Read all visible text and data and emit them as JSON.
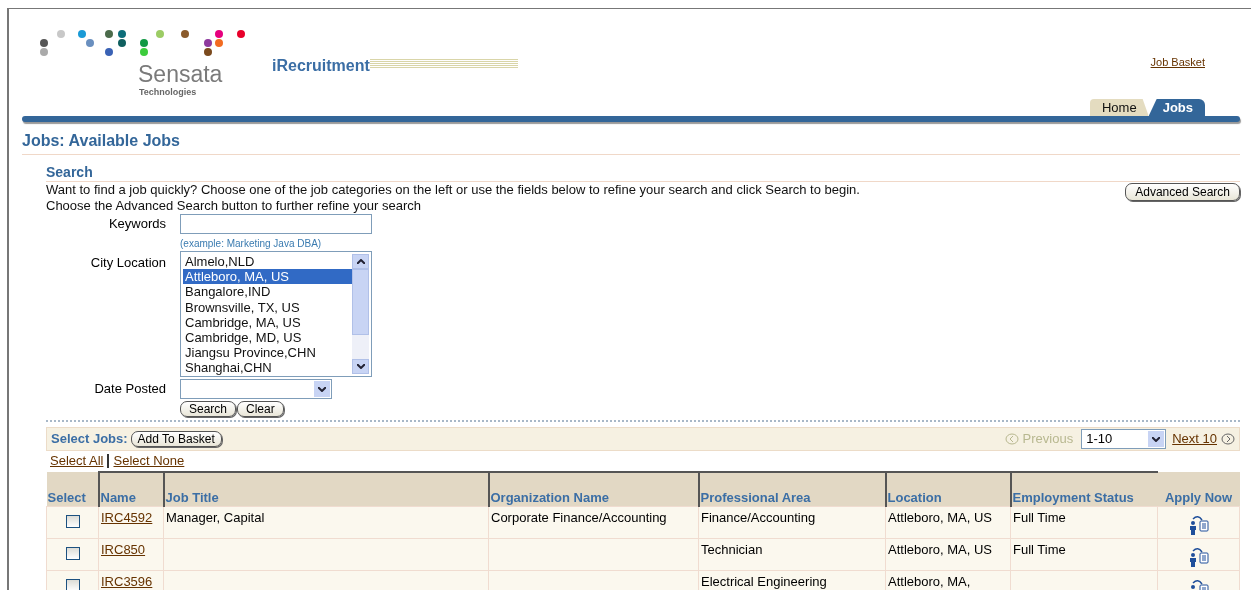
{
  "header": {
    "logo_name": "Sensata",
    "logo_subtitle": "Technologies",
    "app_title": "iRecruitment",
    "global_link": "Job Basket"
  },
  "tabs": [
    {
      "label": "Home",
      "selected": false
    },
    {
      "label": "Jobs",
      "selected": true
    }
  ],
  "page_title": "Jobs: Available Jobs",
  "search": {
    "heading": "Search",
    "instructions": [
      "Want to find a job quickly? Choose one of the job categories on the left or use the fields below to refine your search and click Search to begin.",
      "Choose the Advanced Search button to further refine your search"
    ],
    "advanced_button": "Advanced Search",
    "keywords": {
      "label": "Keywords",
      "hint": "(example: Marketing Java DBA)"
    },
    "city_location": {
      "label": "City Location",
      "options": [
        {
          "label": "Almelo,NLD",
          "selected": false
        },
        {
          "label": "Attleboro, MA, US",
          "selected": true
        },
        {
          "label": "Bangalore,IND",
          "selected": false
        },
        {
          "label": "Brownsville, TX, US",
          "selected": false
        },
        {
          "label": "Cambridge, MA, US",
          "selected": false
        },
        {
          "label": "Cambridge, MD, US",
          "selected": false
        },
        {
          "label": "Jiangsu Province,CHN",
          "selected": false
        },
        {
          "label": "Shanghai,CHN",
          "selected": false
        }
      ]
    },
    "date_posted": {
      "label": "Date Posted"
    },
    "buttons": [
      "Search",
      "Clear"
    ]
  },
  "results": {
    "select_label": "Select Jobs:",
    "add_button": "Add To Basket",
    "previous": {
      "label": "Previous",
      "disabled": true
    },
    "range": "1-10",
    "next": "Next 10",
    "select_all": "Select All",
    "select_none": "Select None",
    "columns": [
      "Select",
      "Name",
      "Job Title",
      "Organization Name",
      "Professional Area",
      "Location",
      "Employment Status",
      "Apply Now"
    ],
    "rows": [
      {
        "checked": false,
        "name": "IRC4592",
        "job_title": "Manager, Capital",
        "organization": "Corporate Finance/Accounting",
        "professional_area": "Finance/Accounting",
        "location": "Attleboro, MA, US",
        "employment_status": "Full Time"
      },
      {
        "checked": false,
        "name": "IRC850",
        "professional_area": "Technician",
        "location": "Attleboro, MA, US",
        "employment_status": "Full Time"
      },
      {
        "checked": false,
        "name": "IRC3596",
        "professional_area": "Electrical Engineering",
        "location": "Attleboro, MA,"
      }
    ]
  }
}
